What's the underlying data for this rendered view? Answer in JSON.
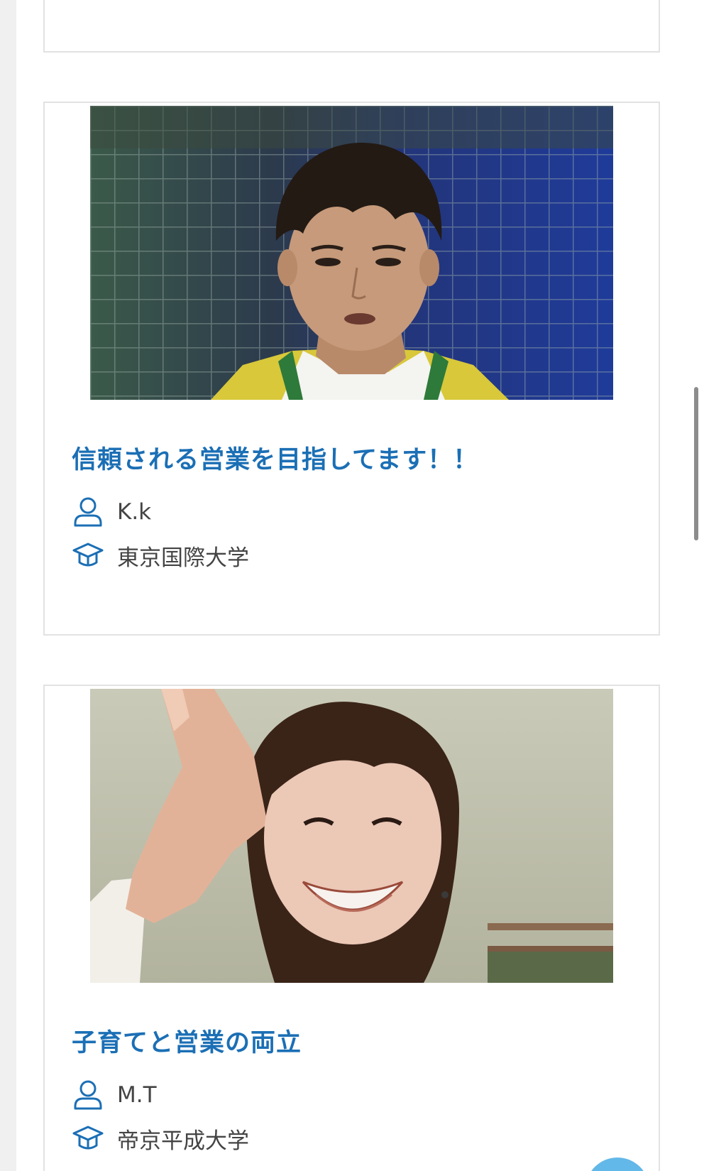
{
  "cards": [
    {
      "title": "信頼される営業を目指してます！！",
      "name": "K.k",
      "school": "東京国際大学",
      "photo_alt": "Portrait photo of K.k"
    },
    {
      "title": "子育てと営業の両立",
      "name": "M.T",
      "school": "帝京平成大学",
      "photo_alt": "Portrait photo of M.T"
    }
  ],
  "icons": {
    "person": "person-icon",
    "school": "graduation-cap-icon"
  },
  "colors": {
    "title": "#1b6fb5",
    "icon": "#1b6fb5",
    "meta_text": "#444444",
    "card_border": "#e2e2e2",
    "page_background": "#f0f0f0",
    "fab": "#62b8e8"
  }
}
